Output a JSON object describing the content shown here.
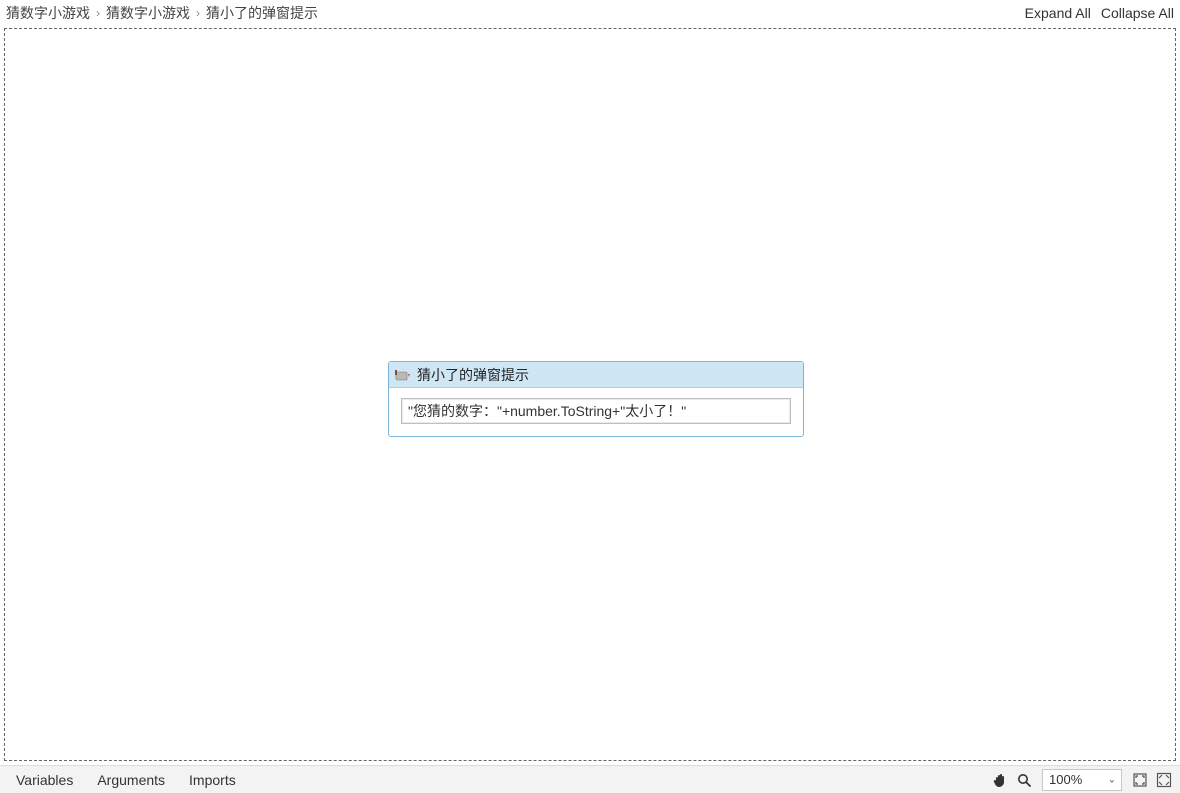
{
  "breadcrumbs": {
    "items": [
      {
        "label": "猜数字小游戏"
      },
      {
        "label": "猜数字小游戏"
      },
      {
        "label": "猜小了的弹窗提示"
      }
    ],
    "separator": "›"
  },
  "topbar": {
    "expand_all": "Expand All",
    "collapse_all": "Collapse All"
  },
  "activity": {
    "title": "猜小了的弹窗提示",
    "icon_name": "messagebox-icon",
    "expression": "\"您猜的数字：\"+number.ToString+\"太小了！\""
  },
  "bottombar": {
    "tabs": {
      "variables": "Variables",
      "arguments": "Arguments",
      "imports": "Imports"
    },
    "zoom": {
      "value": "100%"
    }
  }
}
